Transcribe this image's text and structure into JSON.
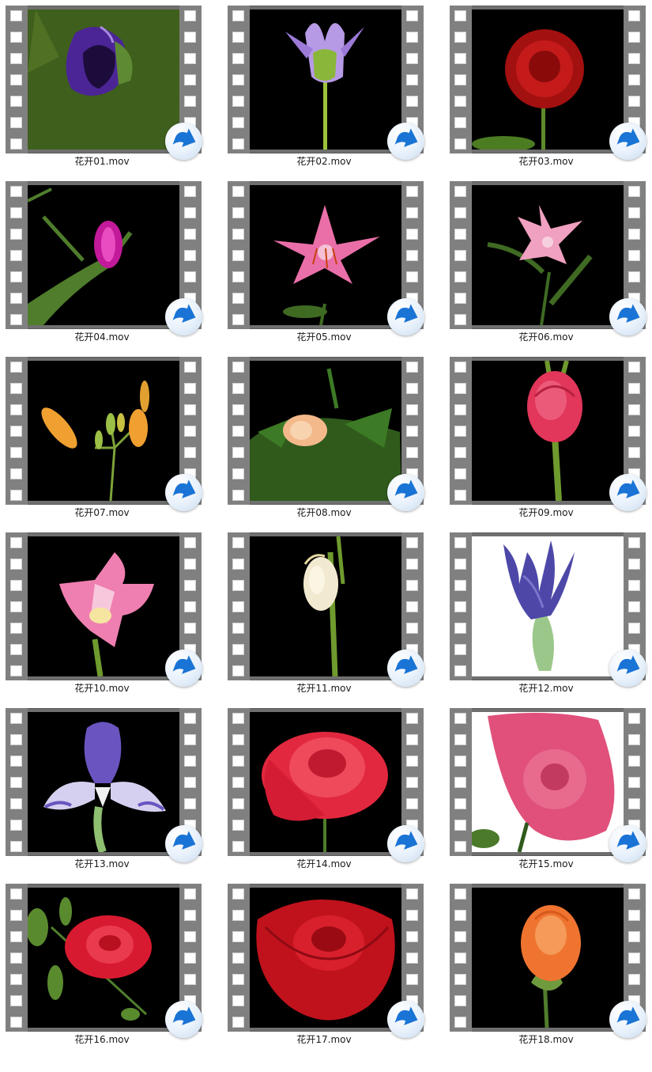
{
  "files": [
    {
      "name": "花开01.mov",
      "thumbnail": "purple-bud",
      "bg": "#4a6a22",
      "flower_color": "#5a2fa8",
      "icon": "movie-file-icon"
    },
    {
      "name": "花开02.mov",
      "thumbnail": "lotus",
      "bg": "#000000",
      "flower_color": "#b79ae6",
      "icon": "movie-file-icon"
    },
    {
      "name": "花开03.mov",
      "thumbnail": "dahlia",
      "bg": "#000000",
      "flower_color": "#b81515",
      "icon": "movie-file-icon"
    },
    {
      "name": "花开04.mov",
      "thumbnail": "magenta-bud",
      "bg": "#000000",
      "flower_color": "#c21a9a",
      "icon": "movie-file-icon"
    },
    {
      "name": "花开05.mov",
      "thumbnail": "pink-lily",
      "bg": "#000000",
      "flower_color": "#ea6fa8",
      "icon": "movie-file-icon"
    },
    {
      "name": "花开06.mov",
      "thumbnail": "pink-lily-side",
      "bg": "#000000",
      "flower_color": "#f0a0c0",
      "icon": "movie-file-icon"
    },
    {
      "name": "花开07.mov",
      "thumbnail": "orange-lily-buds",
      "bg": "#000000",
      "flower_color": "#f0a030",
      "icon": "movie-file-icon"
    },
    {
      "name": "花开08.mov",
      "thumbnail": "peach-bud-leaves",
      "bg": "#000000",
      "flower_color": "#f3b98a",
      "icon": "movie-file-icon"
    },
    {
      "name": "花开09.mov",
      "thumbnail": "pink-carnation",
      "bg": "#000000",
      "flower_color": "#e2365a",
      "icon": "movie-file-icon"
    },
    {
      "name": "花开10.mov",
      "thumbnail": "gladiolus",
      "bg": "#000000",
      "flower_color": "#ef7fb0",
      "icon": "movie-file-icon"
    },
    {
      "name": "花开11.mov",
      "thumbnail": "cream-gladiolus",
      "bg": "#000000",
      "flower_color": "#f2ead0",
      "icon": "movie-file-icon"
    },
    {
      "name": "花开12.mov",
      "thumbnail": "iris-bud",
      "bg": "#ffffff",
      "flower_color": "#4d48a8",
      "icon": "movie-file-icon"
    },
    {
      "name": "花开13.mov",
      "thumbnail": "iris",
      "bg": "#000000",
      "flower_color": "#6a55c0",
      "icon": "movie-file-icon"
    },
    {
      "name": "花开14.mov",
      "thumbnail": "red-rose",
      "bg": "#000000",
      "flower_color": "#e2283e",
      "icon": "movie-file-icon"
    },
    {
      "name": "花开15.mov",
      "thumbnail": "pink-rose",
      "bg": "#ffffff",
      "flower_color": "#e0507a",
      "icon": "movie-file-icon"
    },
    {
      "name": "花开16.mov",
      "thumbnail": "red-rose-leaves",
      "bg": "#000000",
      "flower_color": "#d81a30",
      "icon": "movie-file-icon"
    },
    {
      "name": "花开17.mov",
      "thumbnail": "deep-red-rose",
      "bg": "#000000",
      "flower_color": "#c0121c",
      "icon": "movie-file-icon"
    },
    {
      "name": "花开18.mov",
      "thumbnail": "orange-rose",
      "bg": "#000000",
      "flower_color": "#ef7430",
      "icon": "movie-file-icon"
    }
  ],
  "colors": {
    "film_strip": "#808080",
    "play_badge_arrow": "#1a74d6",
    "label_text": "#1a1a1a"
  }
}
